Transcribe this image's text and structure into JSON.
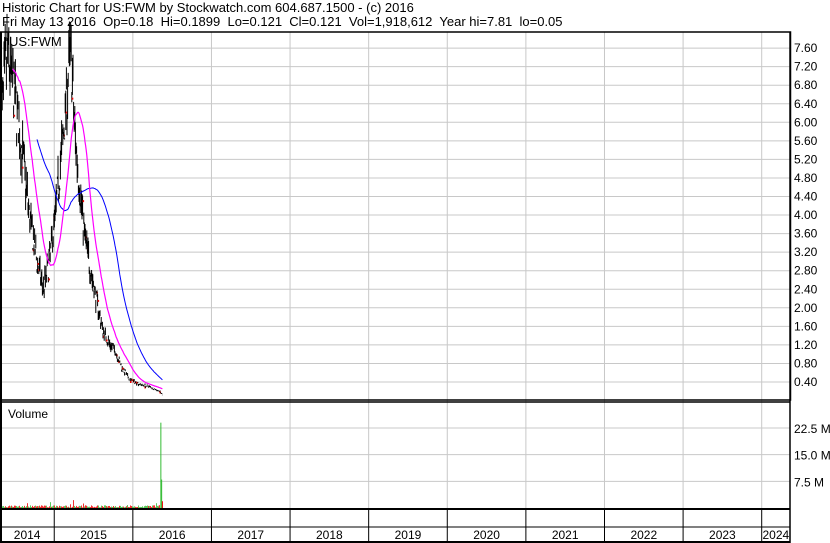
{
  "header": {
    "title": "Historic Chart for US:FWM by Stockwatch.com 604.687.1500 - (c) 2016",
    "quote": "Fri May 13 2016  Op=0.18  Hi=0.1899  Lo=0.121  Cl=0.121  Vol=1,918,612  Year hi=7.81  lo=0.05"
  },
  "chart_data": [
    {
      "type": "line",
      "title": "US:FWM",
      "ylim": [
        0,
        7.9
      ],
      "yticks": [
        "0.40",
        "0.80",
        "1.20",
        "1.60",
        "2.00",
        "2.40",
        "2.80",
        "3.20",
        "3.60",
        "4.00",
        "4.40",
        "4.80",
        "5.20",
        "5.60",
        "6.00",
        "6.40",
        "6.80",
        "7.20",
        "7.60"
      ],
      "x_range_years": [
        2014.31,
        2024.36
      ],
      "series": [
        {
          "name": "price",
          "x": [
            2014.31,
            2014.4,
            2014.5,
            2014.59,
            2014.69,
            2014.78,
            2014.86,
            2014.94,
            2015.02,
            2015.12,
            2015.21,
            2015.26,
            2015.33,
            2015.39,
            2015.52,
            2015.62,
            2015.71,
            2015.77,
            2015.86,
            2015.96,
            2016.09,
            2016.21,
            2016.34,
            2016.38
          ],
          "y": [
            5.8,
            7.5,
            6.5,
            5.4,
            3.9,
            3.0,
            2.4,
            3.0,
            4.1,
            5.8,
            7.6,
            5.8,
            4.5,
            3.5,
            2.3,
            1.5,
            1.2,
            1.1,
            0.7,
            0.45,
            0.35,
            0.3,
            0.2,
            0.121
          ]
        },
        {
          "name": "short-ma",
          "color": "#ff00ff"
        },
        {
          "name": "long-ma",
          "color": "#0000ff"
        }
      ]
    },
    {
      "type": "bar",
      "title": "Volume",
      "yticks": [
        "7.5 M",
        "15.0 M",
        "22.5 M"
      ],
      "ylim": [
        0,
        27
      ],
      "spikes": [
        {
          "x": 2016.33,
          "value": 0.8
        },
        {
          "x": 2016.35,
          "value": 24.0
        },
        {
          "x": 2016.36,
          "value": 8.0
        },
        {
          "x": 2016.37,
          "value": 1.9
        }
      ],
      "baseline_volume": 0.5
    }
  ],
  "x_axis": {
    "years": [
      "2014",
      "2015",
      "2016",
      "2017",
      "2018",
      "2019",
      "2020",
      "2021",
      "2022",
      "2023",
      "2024"
    ]
  },
  "colors": {
    "up": "#33bb33",
    "down": "#ee0000",
    "grid": "#c8c8c8"
  }
}
